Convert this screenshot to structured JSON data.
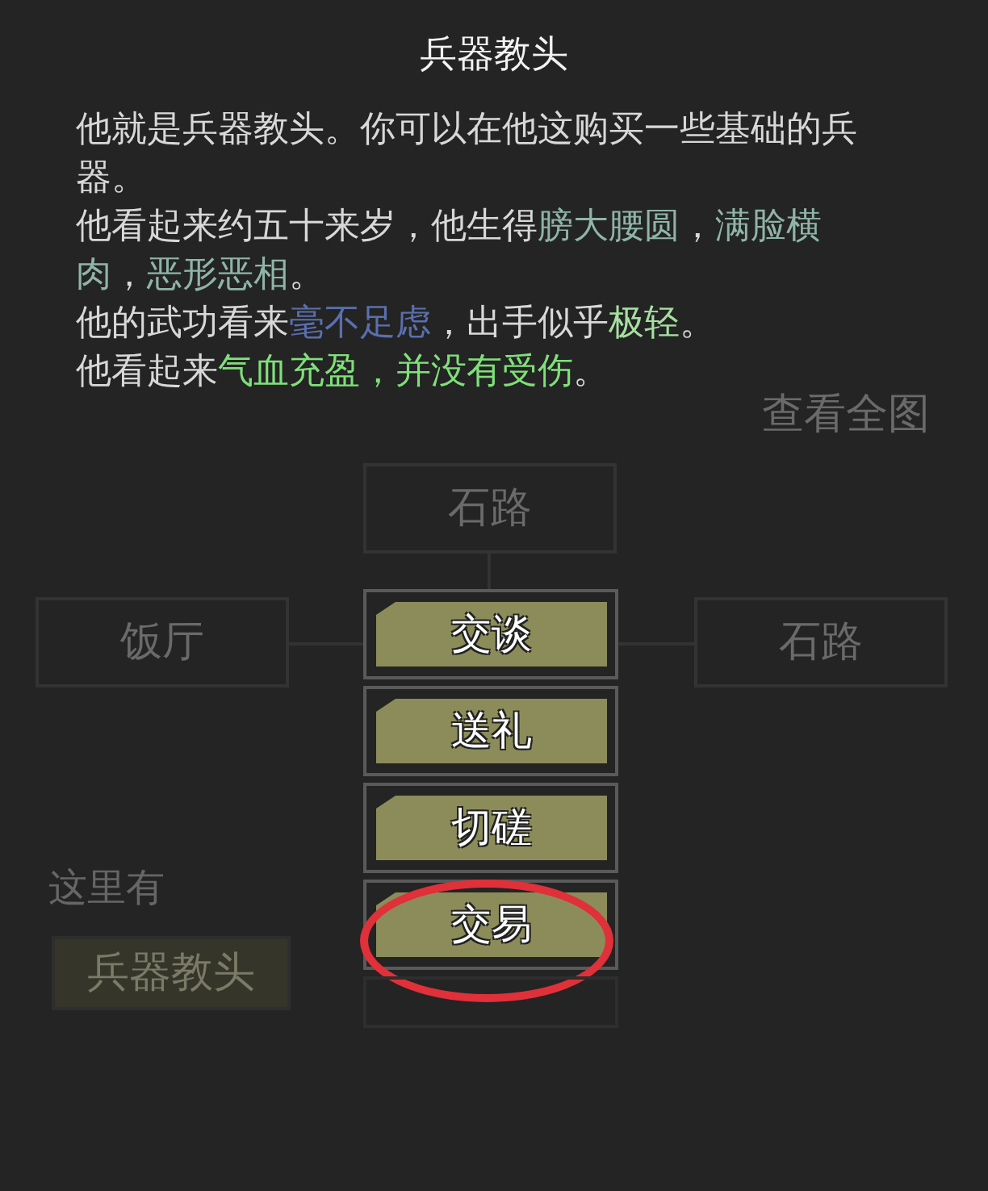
{
  "title": "兵器教头",
  "description": [
    [
      {
        "text": "他就是兵器教头。你可以在他这购买一些基础的兵器。",
        "color": "#d8d8d8"
      }
    ],
    [
      {
        "text": "他看起来约五十来岁，他生得",
        "color": "#d8d8d8"
      },
      {
        "text": "膀大腰圆",
        "color": "#8fb5a8"
      },
      {
        "text": "，",
        "color": "#d8d8d8"
      },
      {
        "text": "满脸横肉",
        "color": "#8fb5a8"
      },
      {
        "text": "，",
        "color": "#d8d8d8"
      },
      {
        "text": "恶形恶相",
        "color": "#8fb5a8"
      },
      {
        "text": "。",
        "color": "#d8d8d8"
      }
    ],
    [
      {
        "text": "他的武功看来",
        "color": "#d8d8d8"
      },
      {
        "text": "毫不足虑",
        "color": "#5a6fae"
      },
      {
        "text": "，出手似乎",
        "color": "#d8d8d8"
      },
      {
        "text": "极轻",
        "color": "#a6e0a0"
      },
      {
        "text": "。",
        "color": "#d8d8d8"
      }
    ],
    [
      {
        "text": "他看起来",
        "color": "#d8d8d8"
      },
      {
        "text": "气血充盈，并没有受伤",
        "color": "#7fe07a"
      },
      {
        "text": "。",
        "color": "#d8d8d8"
      }
    ]
  ],
  "actions": [
    {
      "kind": "button",
      "label": "交谈",
      "circled": false
    },
    {
      "kind": "button",
      "label": "送礼",
      "circled": false
    },
    {
      "kind": "button",
      "label": "切磋",
      "circled": false
    },
    {
      "kind": "button",
      "label": "交易",
      "circled": true
    },
    {
      "kind": "blank"
    }
  ],
  "background": {
    "map_button": "查看全图",
    "rooms": [
      {
        "name": "石路"
      },
      {
        "name": "饭厅"
      },
      {
        "name": "石路"
      }
    ],
    "here_label": "这里有",
    "npcs": [
      "兵器教头"
    ]
  }
}
